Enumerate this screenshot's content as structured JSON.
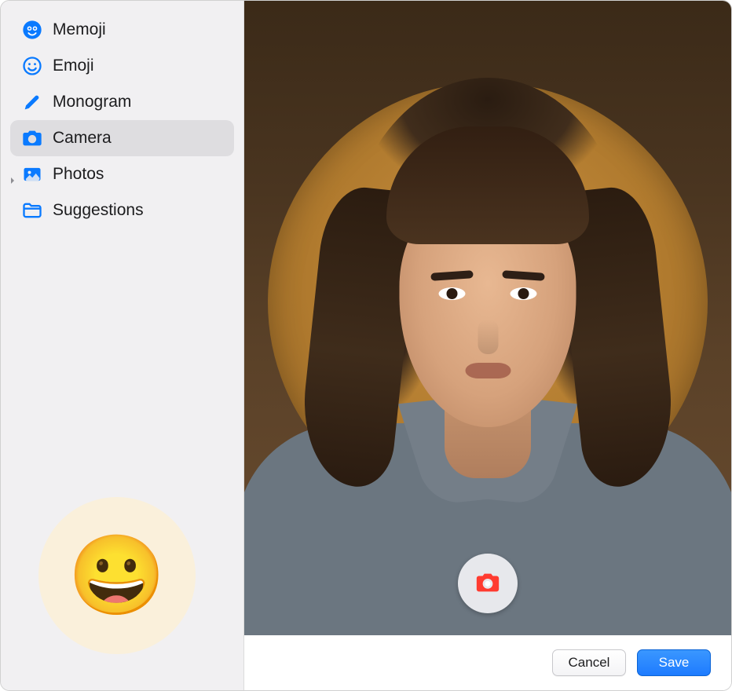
{
  "sidebar": {
    "items": [
      {
        "label": "Memoji",
        "icon": "memoji"
      },
      {
        "label": "Emoji",
        "icon": "emoji"
      },
      {
        "label": "Monogram",
        "icon": "monogram"
      },
      {
        "label": "Camera",
        "icon": "camera"
      },
      {
        "label": "Photos",
        "icon": "photos",
        "expandable": true
      },
      {
        "label": "Suggestions",
        "icon": "suggestions"
      }
    ],
    "selected": "Camera"
  },
  "preview": {
    "emoji": "😀"
  },
  "footer": {
    "cancel_label": "Cancel",
    "save_label": "Save"
  }
}
